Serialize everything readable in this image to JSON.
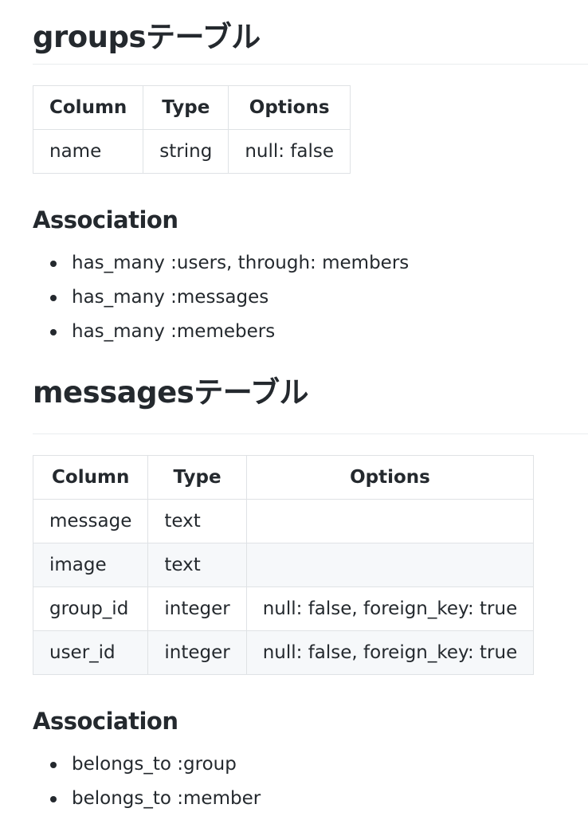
{
  "sections": [
    {
      "heading": "groupsテーブル",
      "table": {
        "headers": [
          "Column",
          "Type",
          "Options"
        ],
        "rows": [
          [
            "name",
            "string",
            "null: false"
          ]
        ]
      },
      "association_heading": "Association",
      "associations": [
        "has_many :users, through: members",
        "has_many :messages",
        "has_many :memebers"
      ]
    },
    {
      "heading": "messagesテーブル",
      "table": {
        "headers": [
          "Column",
          "Type",
          "Options"
        ],
        "rows": [
          [
            "message",
            "text",
            ""
          ],
          [
            "image",
            "text",
            ""
          ],
          [
            "group_id",
            "integer",
            "null: false, foreign_key: true"
          ],
          [
            "user_id",
            "integer",
            "null: false, foreign_key: true"
          ]
        ]
      },
      "association_heading": "Association",
      "associations": [
        "belongs_to :group",
        "belongs_to :member"
      ]
    }
  ]
}
